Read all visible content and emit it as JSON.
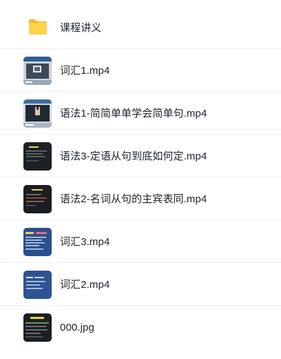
{
  "files": [
    {
      "name": "课程讲义",
      "icon": "folder-icon",
      "type": "folder"
    },
    {
      "name": "词汇1.mp4",
      "icon": "video-thumbnail-icon",
      "type": "video"
    },
    {
      "name": "语法1-简简单单学会简单句.mp4",
      "icon": "video-thumbnail-icon",
      "type": "video"
    },
    {
      "name": "语法3-定语从句到底如何定.mp4",
      "icon": "video-thumbnail-icon",
      "type": "video"
    },
    {
      "name": "语法2-名词从句的主宾表同.mp4",
      "icon": "video-thumbnail-icon",
      "type": "video"
    },
    {
      "name": "词汇3.mp4",
      "icon": "video-thumbnail-icon",
      "type": "video"
    },
    {
      "name": "词汇2.mp4",
      "icon": "video-thumbnail-icon",
      "type": "video"
    },
    {
      "name": "000.jpg",
      "icon": "image-thumbnail-icon",
      "type": "image"
    }
  ],
  "colors": {
    "folder": "#f7c82f",
    "divider": "#eef0f3",
    "text": "#1f2329"
  }
}
